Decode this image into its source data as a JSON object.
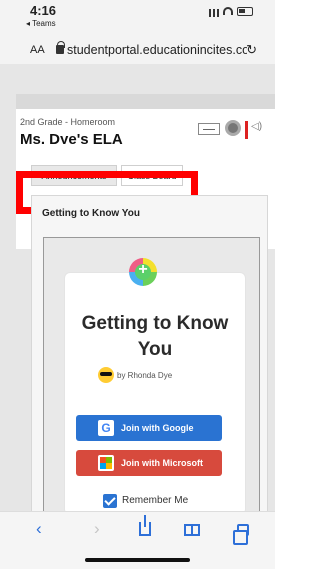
{
  "status": {
    "time": "4:16",
    "back_app": "◂ Teams"
  },
  "browser": {
    "text_size_label": "AA",
    "url": "studentportal.educationincites.co",
    "reload_icon": "reload-icon"
  },
  "course": {
    "grade": "2nd Grade - Homeroom",
    "title": "Ms. Dye's ELA"
  },
  "tabs": [
    {
      "label": "Announcements",
      "selected": true
    },
    {
      "label": "Class Board",
      "selected": false
    }
  ],
  "section": {
    "title": "Getting to Know You"
  },
  "embed": {
    "title": "Getting to Know You",
    "author": "by Rhonda Dye",
    "google_label": "Join with Google",
    "microsoft_label": "Join with Microsoft",
    "remember_label": "Remember Me",
    "remember_checked": true,
    "google_color": "#2a73d2",
    "microsoft_color": "#d74a3d"
  },
  "toolbar": {
    "back_icon": "‹",
    "forward_icon": "›"
  },
  "colors": {
    "highlight": "#ff0000",
    "toolbar_accent": "#2d6fd8"
  }
}
